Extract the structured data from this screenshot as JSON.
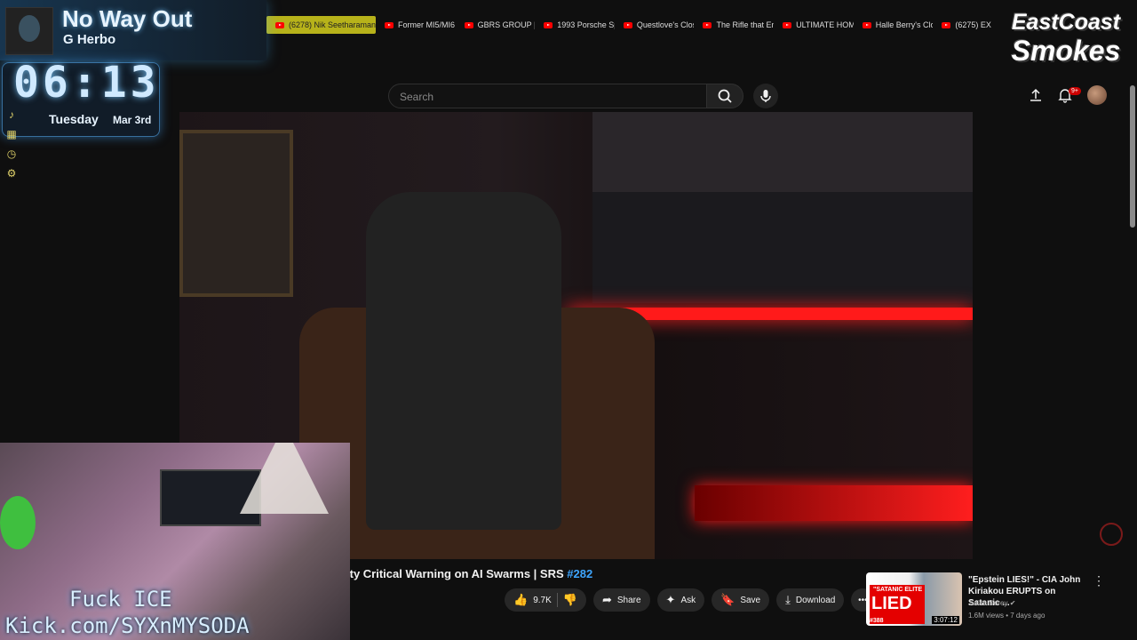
{
  "now_playing": {
    "title": "No Way Out",
    "artist": "G Herbo"
  },
  "clock": {
    "time": "06:13",
    "day": "Tuesday",
    "date": "Mar 3rd"
  },
  "bookmarks": [
    "(6278) Nik Seetharaman",
    "Former MI5/MI6",
    "GBRS GROUP | ",
    "1993 Porsche Sp",
    "Questlove's Clos",
    "The Rifle that En",
    "ULTIMATE HOME",
    "Halle Berry's Clo",
    "(6275) EX"
  ],
  "logo": {
    "line1": "EastCoast",
    "line2": "Smokes"
  },
  "search": {
    "placeholder": "Search"
  },
  "notifications": {
    "badge": "9+"
  },
  "video": {
    "title": "ity Critical Warning on AI Swarms | SRS ",
    "tag": "#282"
  },
  "actions": {
    "likes": "9.7K",
    "share": "Share",
    "ask": "Ask",
    "save": "Save",
    "download": "Download"
  },
  "recommendation": {
    "title": "\"Epstein LIES!\" - CIA John Kiriakou ERUPTS on Satanic ...",
    "channel": "Julian Dorey",
    "meta": "1.6M views • 7 days ago",
    "duration": "3:07:12",
    "thumb_top": "\"SATANIC ELITE",
    "thumb_big": "LIED",
    "thumb_episode": "#388"
  },
  "overlay": {
    "line1": "Fuck ICE",
    "line2": "Kick.com/SYXnMYSODA"
  },
  "colors": {
    "accent_red": "#ff0000",
    "link_blue": "#3ea6ff",
    "bookmark_active": "#b7b21a"
  }
}
